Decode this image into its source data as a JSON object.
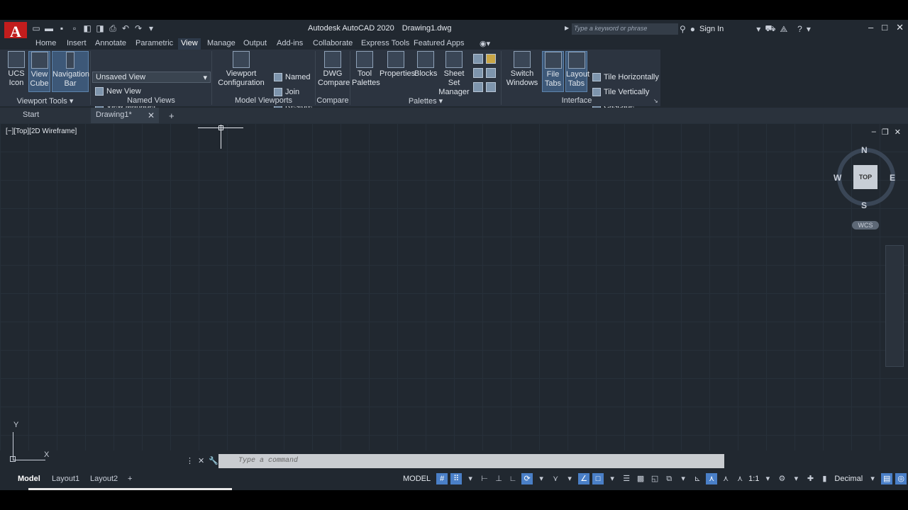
{
  "window": {
    "app_title": "Autodesk AutoCAD 2020",
    "doc_title": "Drawing1.dwg",
    "search_placeholder": "Type a keyword or phrase",
    "sign_in": "Sign In",
    "logo_letter": "A"
  },
  "ribbon_tabs": [
    "Home",
    "Insert",
    "Annotate",
    "Parametric",
    "View",
    "Manage",
    "Output",
    "Add-ins",
    "Collaborate",
    "Express Tools",
    "Featured Apps"
  ],
  "active_tab": "View",
  "ribbon": {
    "viewport_tools": {
      "title": "Viewport Tools",
      "ucs_icon": [
        "UCS",
        "Icon"
      ],
      "view_cube": [
        "View",
        "Cube"
      ],
      "navigation_bar": [
        "Navigation",
        "Bar"
      ]
    },
    "named_views": {
      "title": "Named Views",
      "dropdown_value": "Unsaved View",
      "new_view": "New View",
      "view_manager": "View Manager"
    },
    "model_viewports": {
      "title": "Model Viewports",
      "viewport_config": [
        "Viewport",
        "Configuration"
      ],
      "named": "Named",
      "join": "Join",
      "restore": "Restore"
    },
    "compare": {
      "title": "Compare",
      "dwg_compare": [
        "DWG",
        "Compare"
      ]
    },
    "palettes": {
      "title": "Palettes",
      "tool_palettes": [
        "Tool",
        "Palettes"
      ],
      "properties": "Properties",
      "blocks": "Blocks",
      "sheet_set": [
        "Sheet Set",
        "Manager"
      ]
    },
    "interface": {
      "title": "Interface",
      "switch_windows": [
        "Switch",
        "Windows"
      ],
      "file_tabs": [
        "File",
        "Tabs"
      ],
      "layout_tabs": [
        "Layout",
        "Tabs"
      ],
      "tile_h": "Tile Horizontally",
      "tile_v": "Tile Vertically",
      "cascade": "Cascade"
    }
  },
  "file_tabs": [
    "Start",
    "Drawing1*"
  ],
  "viewport_label": "[−][Top][2D Wireframe]",
  "viewcube": {
    "top": "TOP",
    "n": "N",
    "s": "S",
    "e": "E",
    "w": "W",
    "wcs": "WCS"
  },
  "ucs": {
    "x": "X",
    "y": "Y"
  },
  "command_placeholder": "Type a command",
  "layout_tabs": [
    "Model",
    "Layout1",
    "Layout2"
  ],
  "status": {
    "model": "MODEL",
    "scale": "1:1",
    "units": "Decimal"
  },
  "colors": {
    "accent": "#4a7fc7",
    "background": "#212830",
    "ribbon": "#2c3440",
    "logo": "#c21d1d"
  }
}
